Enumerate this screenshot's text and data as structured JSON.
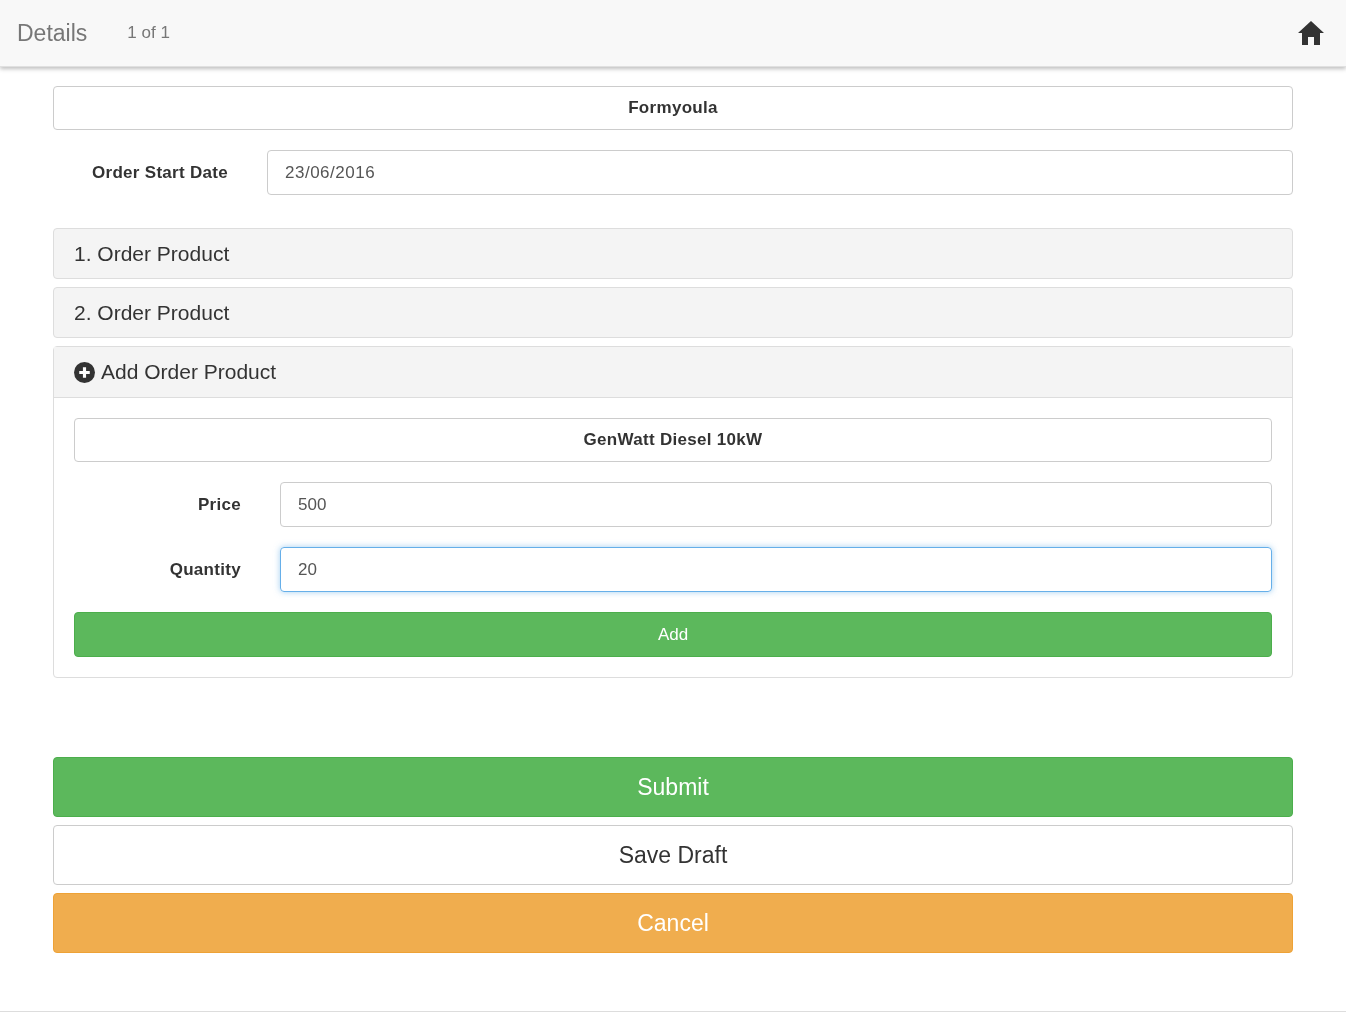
{
  "header": {
    "title": "Details",
    "pager": "1 of 1"
  },
  "form_title": "Formyoula",
  "order_start_date": {
    "label": "Order Start Date",
    "value": "23/06/2016"
  },
  "panels": [
    {
      "kind": "item",
      "label": "1. Order Product"
    },
    {
      "kind": "item",
      "label": "2. Order Product"
    },
    {
      "kind": "add",
      "label": "Add Order Product",
      "expanded": true
    }
  ],
  "product_form": {
    "title": "GenWatt Diesel 10kW",
    "fields": [
      {
        "label": "Price",
        "value": "500",
        "focused": false
      },
      {
        "label": "Quantity",
        "value": "20",
        "focused": true
      }
    ],
    "add_button": "Add"
  },
  "buttons": [
    {
      "kind": "success",
      "label": "Submit"
    },
    {
      "kind": "default",
      "label": "Save Draft"
    },
    {
      "kind": "warning",
      "label": "Cancel"
    }
  ]
}
